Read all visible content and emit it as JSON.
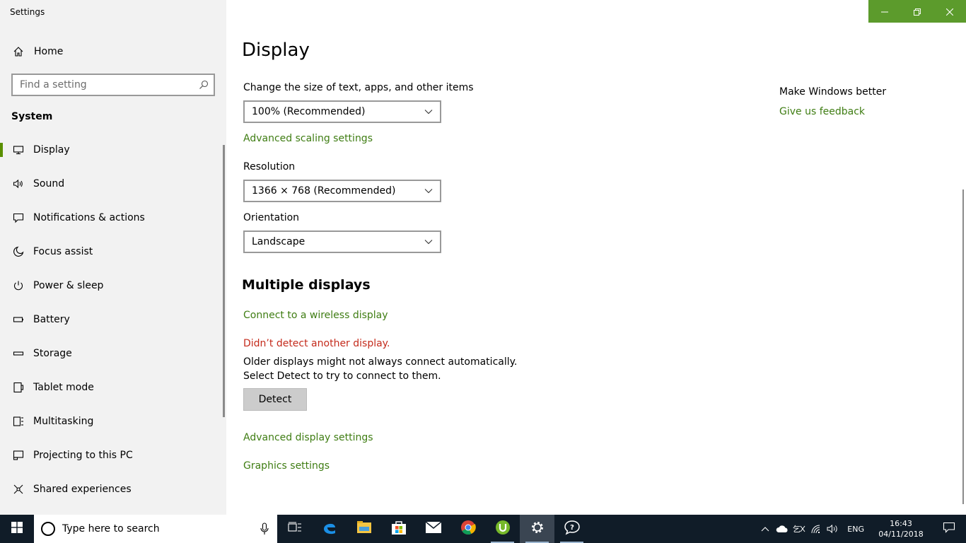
{
  "window": {
    "app_title": "Settings",
    "controls": {
      "minimize_icon": "minimize-icon",
      "restore_icon": "restore-icon",
      "close_icon": "close-icon"
    },
    "accent_color": "#5c9b2c"
  },
  "sidebar": {
    "home_label": "Home",
    "search_placeholder": "Find a setting",
    "section_title": "System",
    "items": [
      {
        "label": "Display",
        "icon": "monitor-icon",
        "selected": true
      },
      {
        "label": "Sound",
        "icon": "speaker-icon"
      },
      {
        "label": "Notifications & actions",
        "icon": "notification-icon"
      },
      {
        "label": "Focus assist",
        "icon": "moon-icon"
      },
      {
        "label": "Power & sleep",
        "icon": "power-icon"
      },
      {
        "label": "Battery",
        "icon": "battery-icon"
      },
      {
        "label": "Storage",
        "icon": "storage-icon"
      },
      {
        "label": "Tablet mode",
        "icon": "tablet-icon"
      },
      {
        "label": "Multitasking",
        "icon": "multitasking-icon"
      },
      {
        "label": "Projecting to this PC",
        "icon": "projecting-icon"
      },
      {
        "label": "Shared experiences",
        "icon": "shared-icon"
      }
    ]
  },
  "main": {
    "title": "Display",
    "scale_label": "Change the size of text, apps, and other items",
    "scale_value": "100% (Recommended)",
    "advanced_scaling_link": "Advanced scaling settings",
    "resolution_label": "Resolution",
    "resolution_value": "1366 × 768 (Recommended)",
    "orientation_label": "Orientation",
    "orientation_value": "Landscape",
    "multiple_displays_title": "Multiple displays",
    "wireless_link": "Connect to a wireless display",
    "detect_error": "Didn’t detect another display.",
    "detect_description": "Older displays might not always connect automatically. Select Detect to try to connect to them.",
    "detect_button": "Detect",
    "advanced_display_link": "Advanced display settings",
    "graphics_link": "Graphics settings",
    "link_color": "#3f7d13",
    "error_color": "#c42b1c"
  },
  "aside": {
    "title": "Make Windows better",
    "feedback_link": "Give us feedback"
  },
  "taskbar": {
    "search_text": "Type here to search",
    "apps": [
      "task-view-icon",
      "edge-icon",
      "file-explorer-icon",
      "store-icon",
      "mail-icon",
      "chrome-icon",
      "utorrent-icon",
      "settings-icon",
      "feedback-hub-icon"
    ],
    "language": "ENG",
    "time": "16:43",
    "date": "04/11/2018"
  }
}
